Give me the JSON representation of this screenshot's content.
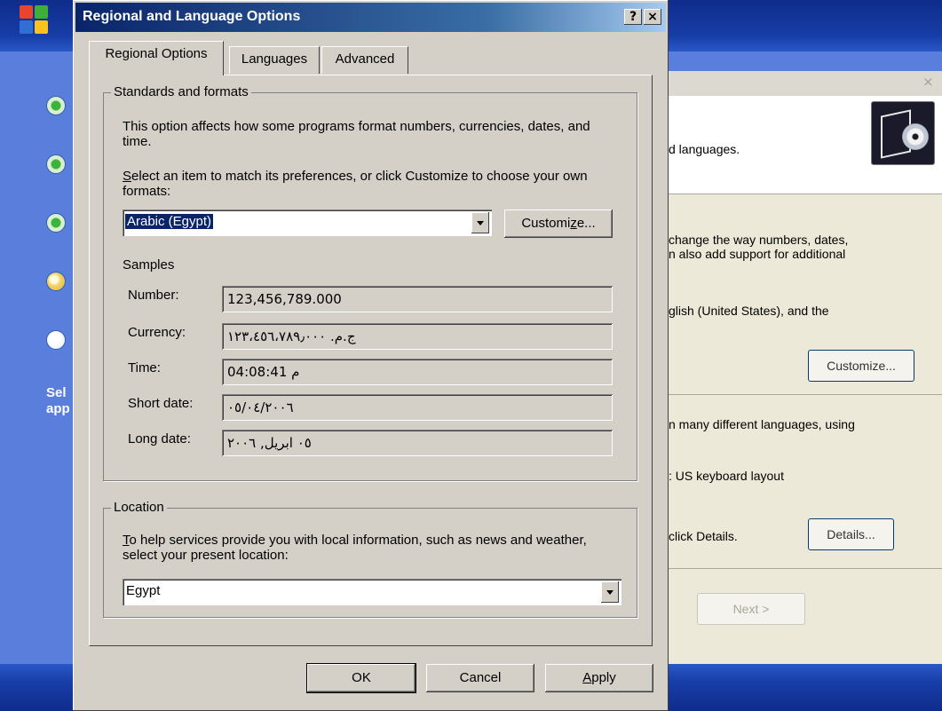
{
  "dialog": {
    "title": "Regional and Language Options",
    "help_button": "?",
    "close_button": "×",
    "tabs": [
      {
        "label": "Regional Options"
      },
      {
        "label": "Languages"
      },
      {
        "label": "Advanced"
      }
    ],
    "standards": {
      "legend": "Standards and formats",
      "description": "This option affects how some programs format numbers, currencies, dates, and time.",
      "select_prompt_pre": "",
      "select_prompt_u": "S",
      "select_prompt_post": "elect an item to match its preferences, or click Customize to choose your own formats:",
      "format_value": "Arabic (Egypt)",
      "customize_pre": "Customi",
      "customize_u": "z",
      "customize_post": "e..."
    },
    "samples": {
      "heading": "Samples",
      "rows": [
        {
          "label": "Number:",
          "value": "123,456,789.000"
        },
        {
          "label": "Currency:",
          "value": "ج.م.‏ ١٢٣،٤٥٦،٧٨٩٫٠٠٠"
        },
        {
          "label": "Time:",
          "value": "04:08:41 م"
        },
        {
          "label": "Short date:",
          "value": "٠٥/٠٤/٢٠٠٦"
        },
        {
          "label": "Long date:",
          "value": "٠٥ ابريل, ٢٠٠٦"
        }
      ]
    },
    "location": {
      "legend": "Location",
      "description_u": "T",
      "description_post": "o help services provide you with local information, such as news and weather, select your present location:",
      "value": "Egypt"
    },
    "buttons": {
      "ok": "OK",
      "cancel": "Cancel",
      "apply_u": "A",
      "apply_post": "pply"
    }
  },
  "background": {
    "side_text": "Sel\napp",
    "wizard": {
      "close": "×",
      "header_text": "d languages.",
      "para1": "change the way numbers, dates,\nn also add support for additional",
      "para2": "glish (United States), and the",
      "customize_button": "Customize...",
      "para3": "n many different languages, using",
      "para4": ": US keyboard layout",
      "para5": "click Details.",
      "details_button": "Details...",
      "next_button": "Next >"
    }
  }
}
